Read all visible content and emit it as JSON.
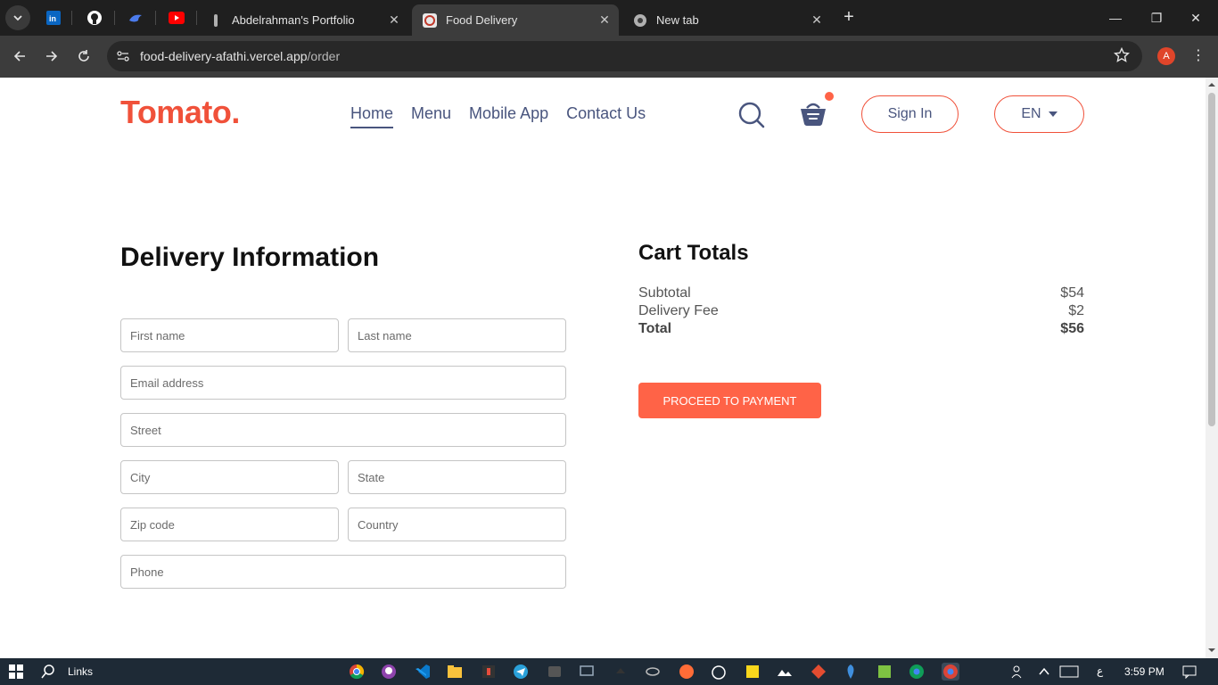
{
  "browser": {
    "tabs": [
      {
        "title": "Abdelrahman's Portfolio",
        "icon": "portfolio-favicon"
      },
      {
        "title": "Food Delivery",
        "icon": "tomato-favicon",
        "active": true
      },
      {
        "title": "New tab",
        "icon": "chrome-icon"
      }
    ],
    "pinned": [
      "linkedin-icon",
      "github-icon",
      "bird-icon",
      "youtube-icon"
    ],
    "url_host": "food-delivery-afathi.vercel.app",
    "url_path": "/order",
    "profile_initial": "A",
    "close_glyph": "✕",
    "new_tab_glyph": "+",
    "window_controls": {
      "minimize": "—",
      "maximize": "❐",
      "close": "✕"
    },
    "kebab_glyph": "⋮"
  },
  "header": {
    "logo": "Tomato.",
    "nav": [
      "Home",
      "Menu",
      "Mobile App",
      "Contact Us"
    ],
    "sign_in": "Sign In",
    "language": "EN"
  },
  "delivery": {
    "title": "Delivery Information",
    "placeholders": {
      "first_name": "First name",
      "last_name": "Last name",
      "email": "Email address",
      "street": "Street",
      "city": "City",
      "state": "State",
      "zip": "Zip code",
      "country": "Country",
      "phone": "Phone"
    }
  },
  "cart": {
    "title": "Cart Totals",
    "subtotal_label": "Subtotal",
    "subtotal": "$54",
    "delivery_label": "Delivery Fee",
    "delivery": "$2",
    "total_label": "Total",
    "total": "$56",
    "button": "PROCEED TO PAYMENT"
  },
  "colors": {
    "brand": "#f0513a",
    "accent": "#ff6347",
    "nav_text": "#49557e"
  },
  "taskbar": {
    "links_label": "Links",
    "time": "3:59 PM",
    "lang_indicator": "ع"
  }
}
